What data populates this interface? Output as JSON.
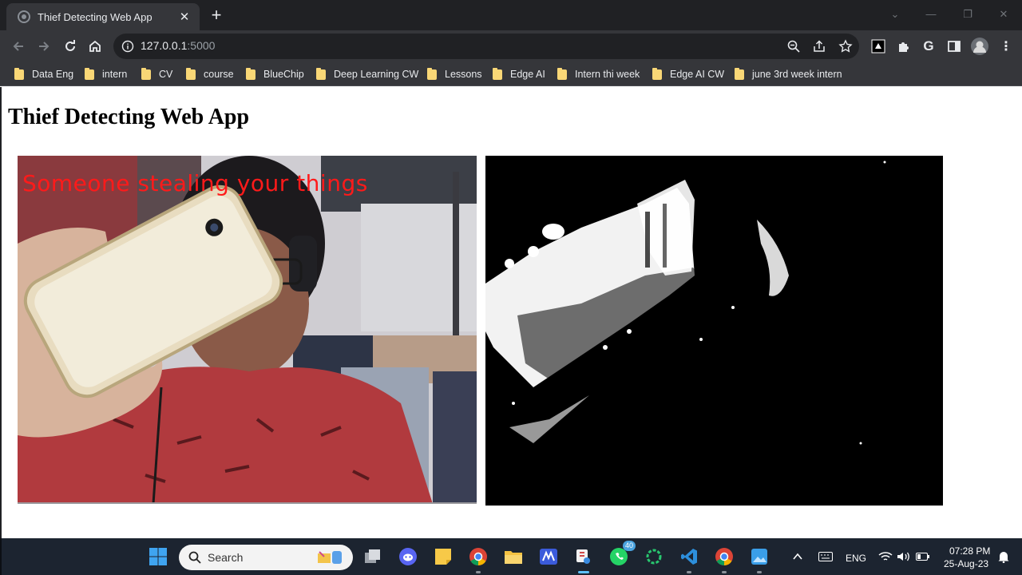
{
  "browser": {
    "tab_title": "Thief Detecting Web App",
    "url_host": "127.0.0.1",
    "url_port": ":5000",
    "bookmarks": [
      "Data Eng",
      "intern",
      "CV",
      "course",
      "BlueChip",
      "Deep Learning CW",
      "Lessons",
      "Edge AI",
      "Intern thi week",
      "Edge AI CW",
      "june 3rd week intern"
    ]
  },
  "page": {
    "heading": "Thief Detecting Web App",
    "camera_overlay": "Someone stealing your things"
  },
  "taskbar": {
    "search_label": "Search",
    "whatsapp_badge": "40",
    "language": "ENG",
    "time": "07:28 PM",
    "date": "25-Aug-23"
  },
  "colors": {
    "overlay_text": "#ff1a1a",
    "chrome_dark": "#202124",
    "chrome_bar": "#35363a",
    "bookmark_folder": "#f9d776"
  }
}
